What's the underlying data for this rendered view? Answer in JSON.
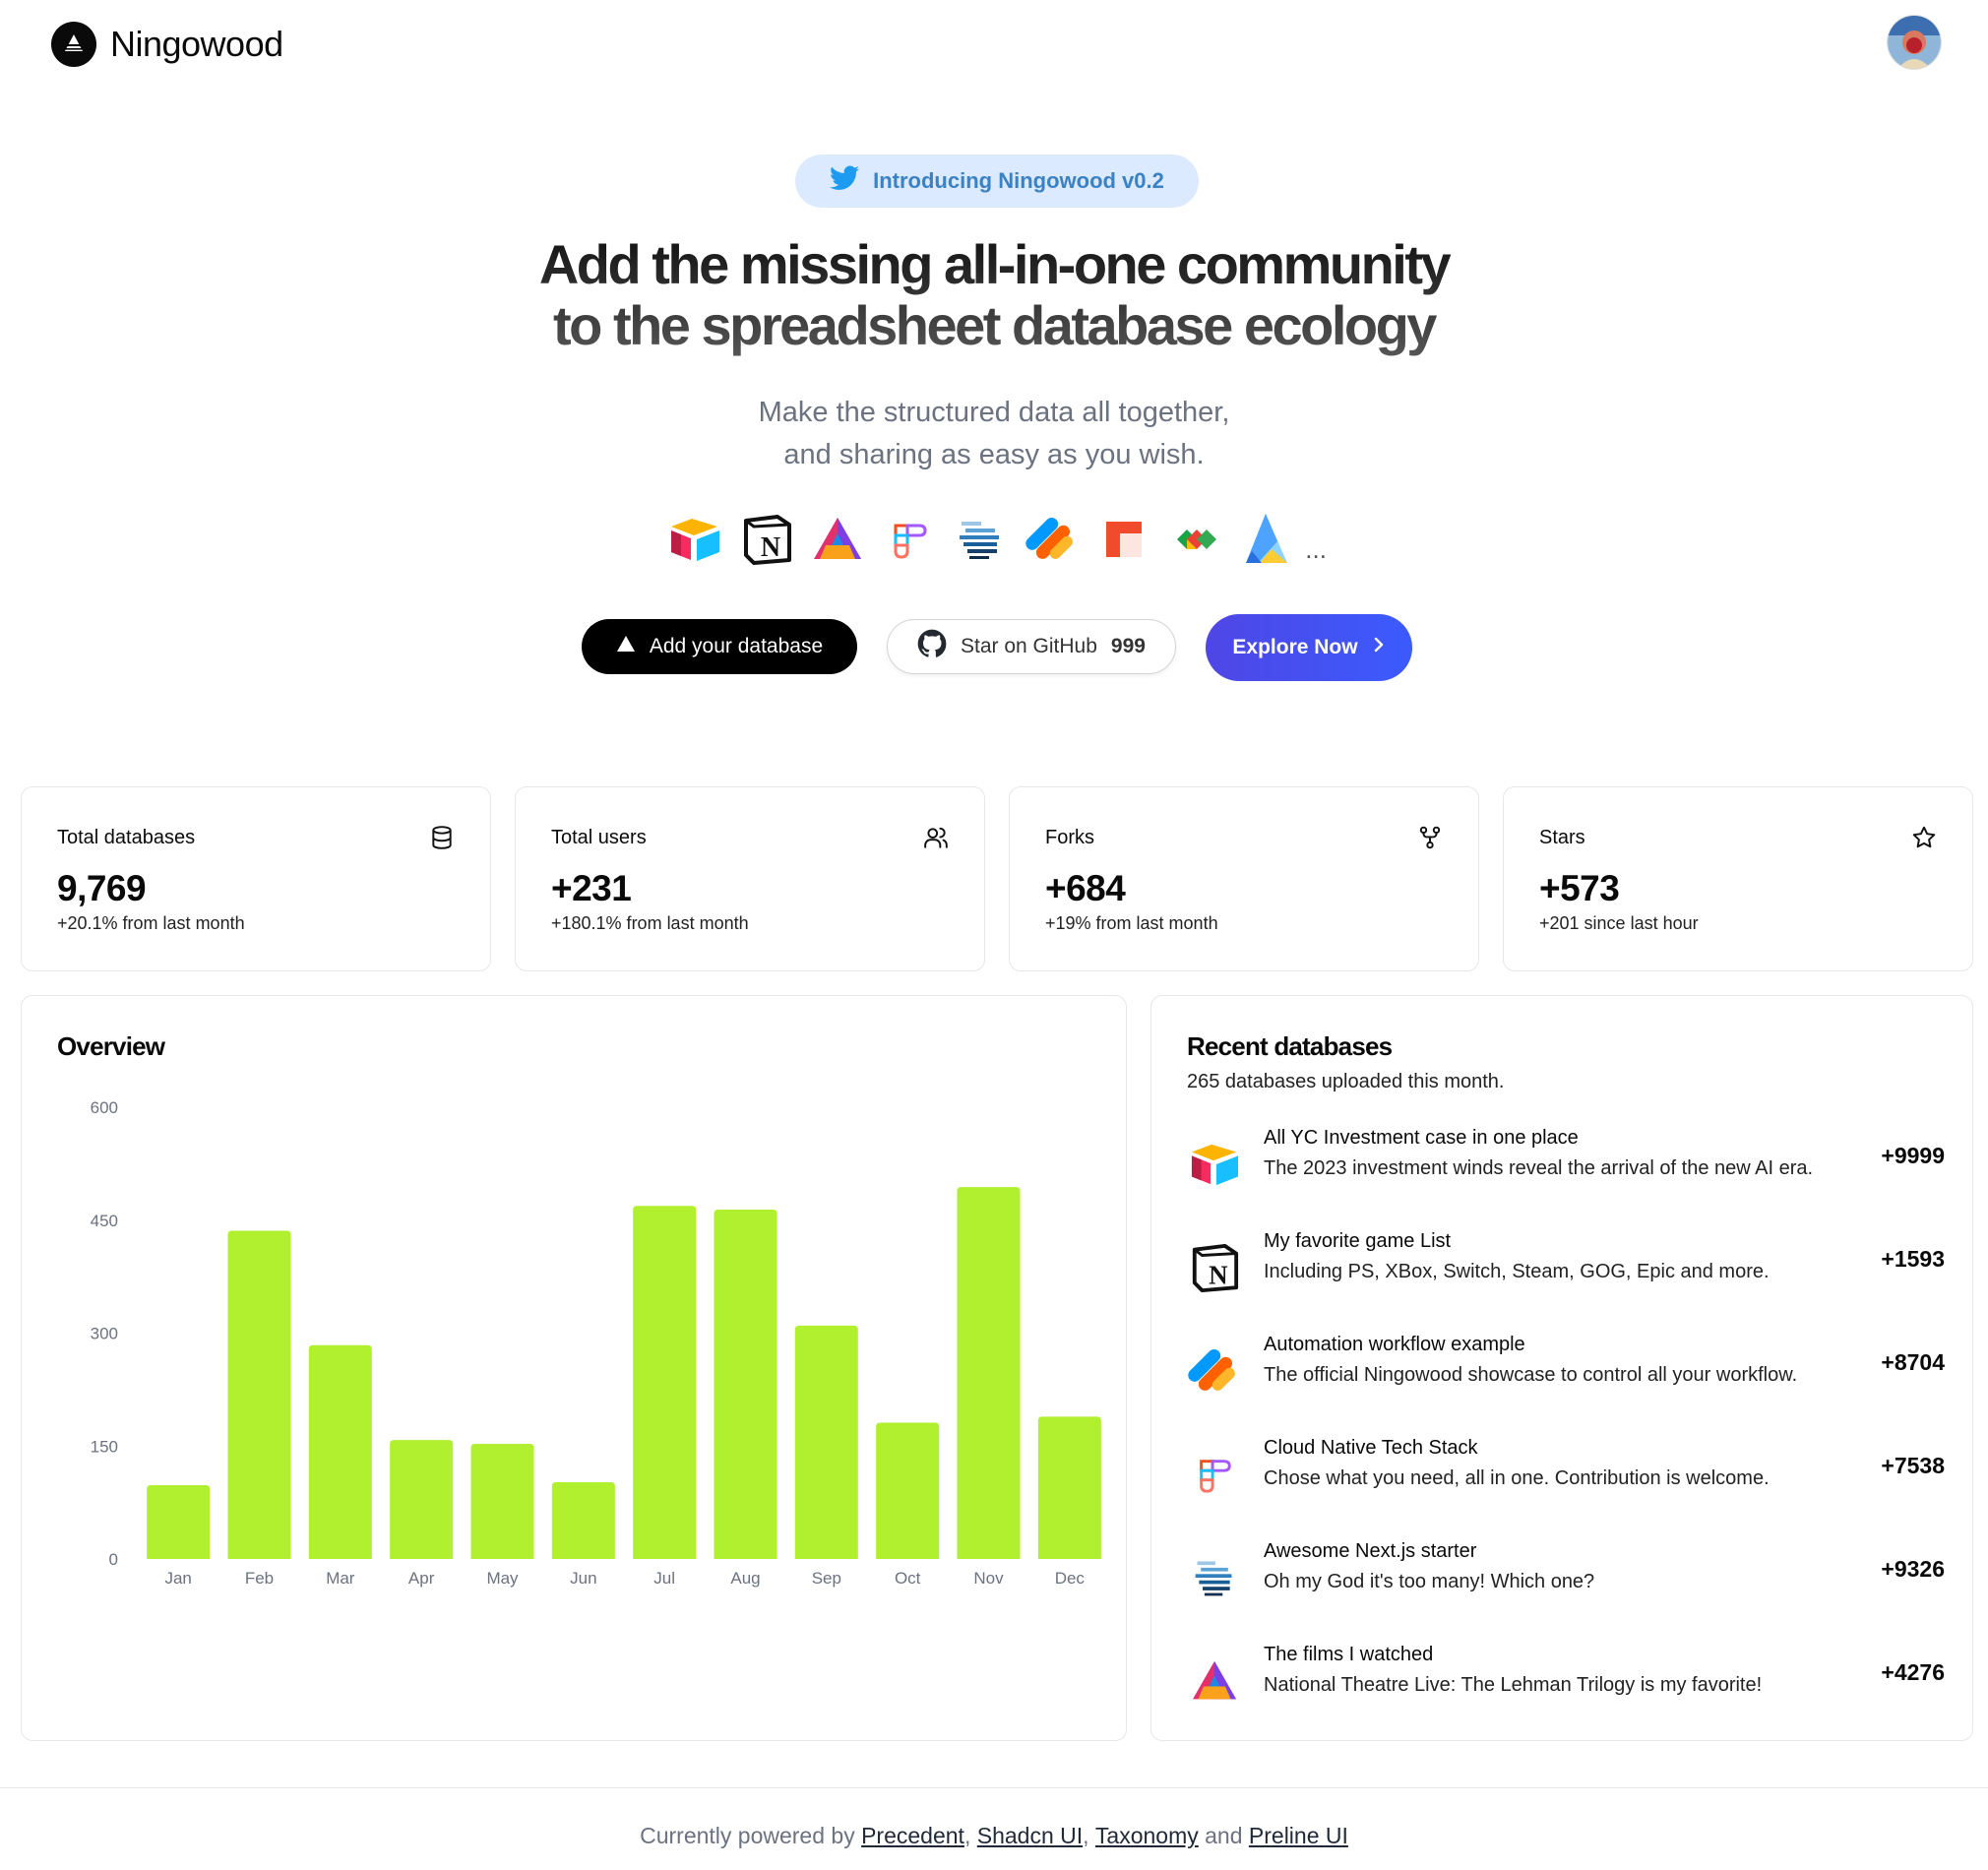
{
  "header": {
    "logo_text": "Ningowood",
    "logo_icon": "ningowood-logo-icon",
    "avatar_icon": "user-avatar"
  },
  "hero": {
    "announcement": "Introducing Ningowood v0.2",
    "announcement_icon": "twitter-icon",
    "title_line1": "Add the missing all-in-one community",
    "title_line2": "to the spreadsheet database ecology",
    "subtitle_line1": "Make the structured data all together,",
    "subtitle_line2": "and sharing as easy as you wish.",
    "integrations": [
      "airtable-icon",
      "notion-icon",
      "coda-icon",
      "figma-icon",
      "stack-icon",
      "jotform-icon",
      "redash-icon",
      "gitlab-arrow-icon",
      "vercel-icon"
    ],
    "integrations_more": "...",
    "buttons": {
      "add_database": "Add your database",
      "github_label": "Star on GitHub",
      "github_count": "999",
      "explore": "Explore Now"
    }
  },
  "stats": [
    {
      "title": "Total databases",
      "value": "9,769",
      "sub": "+20.1% from last month",
      "icon": "database-icon"
    },
    {
      "title": "Total users",
      "value": "+231",
      "sub": "+180.1% from last month",
      "icon": "users-icon"
    },
    {
      "title": "Forks",
      "value": "+684",
      "sub": "+19% from last month",
      "icon": "fork-icon"
    },
    {
      "title": "Stars",
      "value": "+573",
      "sub": "+201 since last hour",
      "icon": "star-icon"
    }
  ],
  "overview": {
    "title": "Overview"
  },
  "chart_data": {
    "type": "bar",
    "title": "Overview",
    "categories": [
      "Jan",
      "Feb",
      "Mar",
      "Apr",
      "May",
      "Jun",
      "Jul",
      "Aug",
      "Sep",
      "Oct",
      "Nov",
      "Dec"
    ],
    "values": [
      98,
      436,
      284,
      158,
      153,
      102,
      469,
      464,
      310,
      181,
      494,
      189
    ],
    "yticks": [
      "600",
      "450",
      "300",
      "150",
      "0"
    ],
    "ylim": [
      0,
      600
    ],
    "bar_color": "#b1f02f",
    "grid": false,
    "legend": "none"
  },
  "recent": {
    "title": "Recent databases",
    "subtitle": "265 databases uploaded this month.",
    "items": [
      {
        "title": "All YC Investment case in one place",
        "desc": "The 2023 investment winds reveal the arrival of the new AI era.",
        "amount": "+9999",
        "icon": "airtable-icon"
      },
      {
        "title": "My favorite game List",
        "desc": "Including PS, XBox, Switch, Steam, GOG, Epic and more.",
        "amount": "+1593",
        "icon": "notion-icon"
      },
      {
        "title": "Automation workflow example",
        "desc": "The official Ningowood showcase to control all your workflow.",
        "amount": "+8704",
        "icon": "jotform-icon"
      },
      {
        "title": "Cloud Native Tech Stack",
        "desc": "Chose what you need, all in one. Contribution is welcome.",
        "amount": "+7538",
        "icon": "figma-icon"
      },
      {
        "title": "Awesome Next.js starter",
        "desc": "Oh my God it's too many! Which one?",
        "amount": "+9326",
        "icon": "stack-icon"
      },
      {
        "title": "The films I watched",
        "desc": "National Theatre Live: The Lehman Trilogy is my favorite!",
        "amount": "+4276",
        "icon": "coda-icon"
      }
    ]
  },
  "footer": {
    "prefix": "Currently powered by",
    "link1": "Precedent",
    "sep1": ",",
    "link2": "Shadcn UI",
    "sep2": ",",
    "link3": "Taxonomy",
    "and": "and",
    "link4": "Preline UI"
  }
}
